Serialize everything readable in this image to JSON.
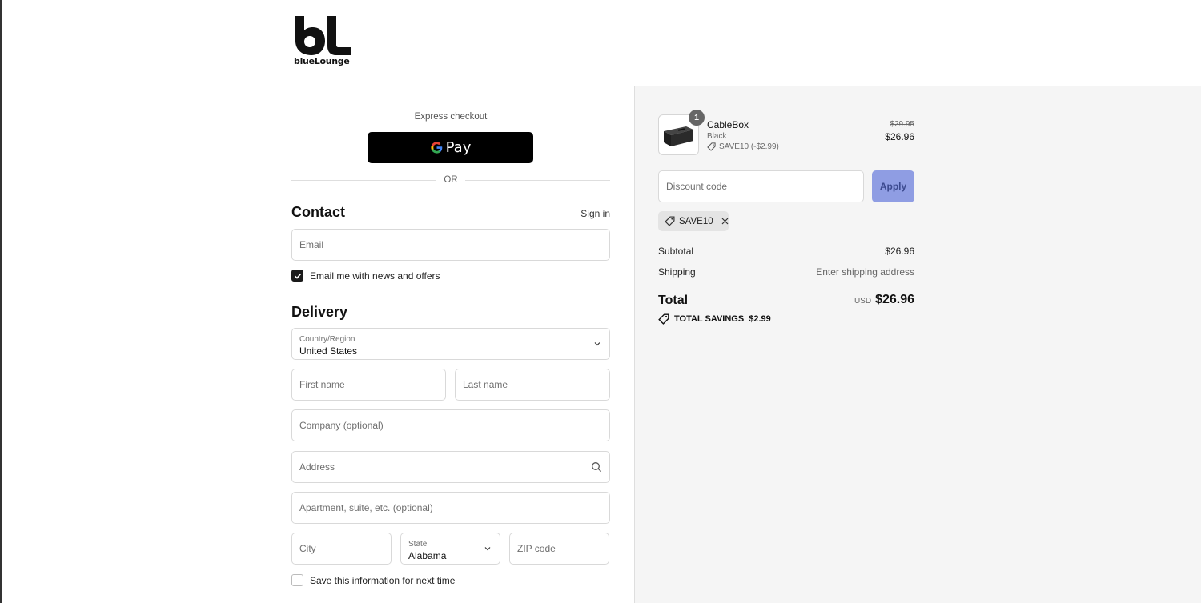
{
  "brand": {
    "name": "blueLounge"
  },
  "express": {
    "label": "Express checkout",
    "gpay_label": "Pay",
    "or_text": "OR"
  },
  "contact": {
    "title": "Contact",
    "signin": "Sign in",
    "email_placeholder": "Email",
    "newsletter_label": "Email me with news and offers",
    "newsletter_checked": true
  },
  "delivery": {
    "title": "Delivery",
    "country_label": "Country/Region",
    "country_value": "United States",
    "first_name": "First name",
    "last_name": "Last name",
    "company": "Company (optional)",
    "address": "Address",
    "apartment": "Apartment, suite, etc. (optional)",
    "city": "City",
    "state_label": "State",
    "state_value": "Alabama",
    "zip": "ZIP code",
    "save_info_label": "Save this information for next time",
    "save_info_checked": false
  },
  "summary": {
    "item": {
      "qty": "1",
      "name": "CableBox",
      "variant": "Black",
      "discount": "SAVE10 (-$2.99)",
      "price_old": "$29.95",
      "price_new": "$26.96"
    },
    "discount_placeholder": "Discount code",
    "apply_label": "Apply",
    "applied_code": "SAVE10",
    "subtotal_label": "Subtotal",
    "subtotal_value": "$26.96",
    "shipping_label": "Shipping",
    "shipping_value": "Enter shipping address",
    "total_label": "Total",
    "total_currency": "USD",
    "total_value": "$26.96",
    "savings_label": "TOTAL SAVINGS",
    "savings_value": "$2.99"
  },
  "colors": {
    "apply_bg": "#8f9de3",
    "summary_bg": "#f5f5f5",
    "gpay_bg": "#000000"
  }
}
